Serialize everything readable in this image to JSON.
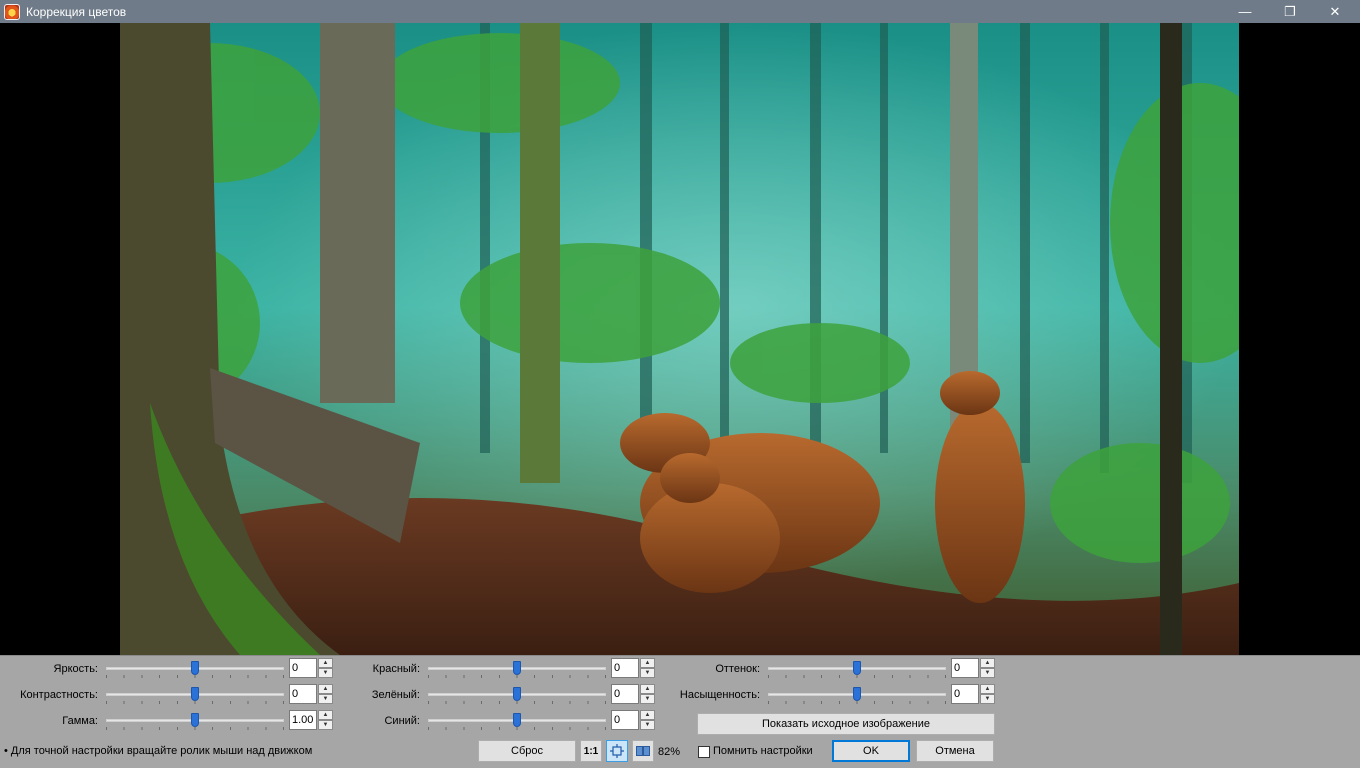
{
  "window": {
    "title": "Коррекция цветов",
    "minimize_glyph": "—",
    "maximize_glyph": "❐",
    "close_glyph": "✕"
  },
  "sliders": {
    "brightness": {
      "label": "Яркость:",
      "value": "0",
      "level": 0.5
    },
    "contrast": {
      "label": "Контрастность:",
      "value": "0",
      "level": 0.5
    },
    "gamma": {
      "label": "Гамма:",
      "value": "1.00",
      "level": 0.5
    },
    "red": {
      "label": "Красный:",
      "value": "0",
      "level": 0.5
    },
    "green": {
      "label": "Зелёный:",
      "value": "0",
      "level": 0.5
    },
    "blue": {
      "label": "Синий:",
      "value": "0",
      "level": 0.5
    },
    "hue": {
      "label": "Оттенок:",
      "value": "0",
      "level": 0.5
    },
    "saturation": {
      "label": "Насыщенность:",
      "value": "0",
      "level": 0.5
    }
  },
  "buttons": {
    "show_original": "Показать исходное изображение",
    "reset": "Сброс",
    "actual_size": "1:1",
    "ok": "OK",
    "cancel": "Отмена"
  },
  "zoom_level": "82%",
  "remember_settings": {
    "label": "Помнить настройки",
    "checked": false
  },
  "hint": "• Для точной настройки вращайте ролик мыши над движком",
  "icons": [
    "app-icon",
    "fit-to-window-icon",
    "compare-icon",
    "spin-up-icon",
    "spin-down-icon"
  ]
}
